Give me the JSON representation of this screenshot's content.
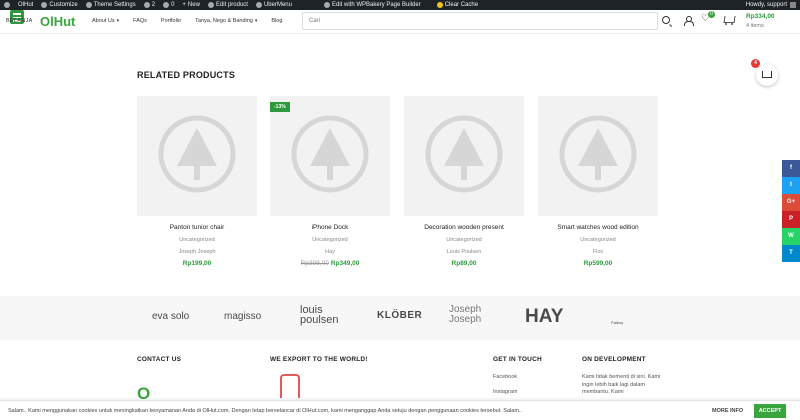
{
  "adminbar": {
    "items": [
      "OlHut",
      "Customize",
      "Theme Settings",
      "2",
      "0",
      "New",
      "Edit product",
      "UberMenu",
      "Edit with WPBakery Page Builder",
      "Clear Cache"
    ],
    "user": "Howdy, support"
  },
  "header": {
    "belanja": "BELANJA",
    "logo": "OlHut",
    "nav": [
      "About Us",
      "FAQs",
      "Portfolio",
      "Tanya, Nego & Banding",
      "Blog"
    ],
    "search_placeholder": "Cari",
    "wishlist_count": "0",
    "cart_total": "Rp334,00",
    "cart_items": "4 items"
  },
  "related": {
    "title": "RELATED PRODUCTS",
    "products": [
      {
        "name": "Panton tunior chair",
        "category": "Uncategorized",
        "brand": "Joseph Joseph",
        "price": "Rp199,00",
        "old_price": "",
        "badge": ""
      },
      {
        "name": "iPhone Dock",
        "category": "Uncategorized",
        "brand": "Hay",
        "price": "Rp349,00",
        "old_price": "Rp398,00",
        "badge": "-13%"
      },
      {
        "name": "Decoration wooden present",
        "category": "Uncategorized",
        "brand": "Louis Poulsen",
        "price": "Rp89,00",
        "old_price": "",
        "badge": ""
      },
      {
        "name": "Smart watches wood edition",
        "category": "Uncategorized",
        "brand": "Flos",
        "price": "Rp599,00",
        "old_price": "",
        "badge": ""
      }
    ]
  },
  "floating_cart_count": "4",
  "social": [
    {
      "label": "f",
      "color": "#3b5998"
    },
    {
      "label": "t",
      "color": "#1da1f2"
    },
    {
      "label": "G+",
      "color": "#dd4b39"
    },
    {
      "label": "P",
      "color": "#cb2027"
    },
    {
      "label": "W",
      "color": "#25d366"
    },
    {
      "label": "T",
      "color": "#0088cc"
    }
  ],
  "brands": [
    "eva solo",
    "magisso",
    "louis poulsen",
    "KLÖBER",
    "Joseph Joseph",
    "HAY",
    "Fatboy"
  ],
  "footer": {
    "contact_title": "CONTACT US",
    "export_title": "WE EXPORT TO THE WORLD!",
    "touch_title": "GET IN TOUCH",
    "touch_links": [
      "Facebook",
      "Instagram"
    ],
    "dev_title": "ON DEVELOPMENT",
    "dev_text": "Kami tidak berhenti di sini. Kami ingin lebih baik lagi dalam membantu. Kami"
  },
  "cookie": {
    "text": "Salam.. Kami menggunakan cookies untuk meningkatkan kenyamanan Anda di OlHut.com. Dengan tetap berselancar di OlHut.com, kami menganggap Anda setuju dengan penggunaan cookies tersebut. Salam..",
    "more_info": "MORE INFO",
    "accept": "ACCEPT"
  },
  "colors": {
    "brand_green": "#3aa53e",
    "admin_bar": "#1d2327",
    "price_green": "#2e9a3d",
    "badge_red": "#e53935"
  }
}
